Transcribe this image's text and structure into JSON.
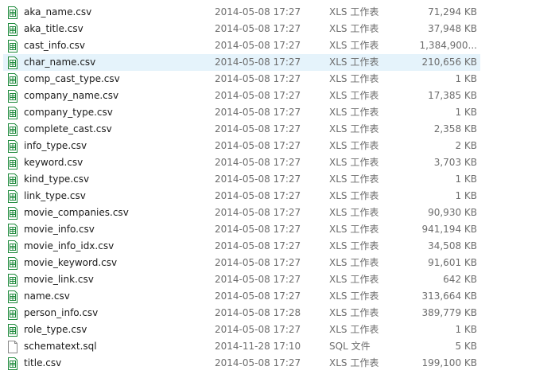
{
  "files": [
    {
      "name": "aka_name.csv",
      "date": "2014-05-08 17:27",
      "type": "XLS 工作表",
      "size": "71,294 KB",
      "icon": "xls-file-icon"
    },
    {
      "name": "aka_title.csv",
      "date": "2014-05-08 17:27",
      "type": "XLS 工作表",
      "size": "37,948 KB",
      "icon": "xls-file-icon"
    },
    {
      "name": "cast_info.csv",
      "date": "2014-05-08 17:27",
      "type": "XLS 工作表",
      "size": "1,384,900...",
      "icon": "xls-file-icon"
    },
    {
      "name": "char_name.csv",
      "date": "2014-05-08 17:27",
      "type": "XLS 工作表",
      "size": "210,656 KB",
      "icon": "xls-file-icon",
      "selected": true
    },
    {
      "name": "comp_cast_type.csv",
      "date": "2014-05-08 17:27",
      "type": "XLS 工作表",
      "size": "1 KB",
      "icon": "xls-file-icon"
    },
    {
      "name": "company_name.csv",
      "date": "2014-05-08 17:27",
      "type": "XLS 工作表",
      "size": "17,385 KB",
      "icon": "xls-file-icon"
    },
    {
      "name": "company_type.csv",
      "date": "2014-05-08 17:27",
      "type": "XLS 工作表",
      "size": "1 KB",
      "icon": "xls-file-icon"
    },
    {
      "name": "complete_cast.csv",
      "date": "2014-05-08 17:27",
      "type": "XLS 工作表",
      "size": "2,358 KB",
      "icon": "xls-file-icon"
    },
    {
      "name": "info_type.csv",
      "date": "2014-05-08 17:27",
      "type": "XLS 工作表",
      "size": "2 KB",
      "icon": "xls-file-icon"
    },
    {
      "name": "keyword.csv",
      "date": "2014-05-08 17:27",
      "type": "XLS 工作表",
      "size": "3,703 KB",
      "icon": "xls-file-icon"
    },
    {
      "name": "kind_type.csv",
      "date": "2014-05-08 17:27",
      "type": "XLS 工作表",
      "size": "1 KB",
      "icon": "xls-file-icon"
    },
    {
      "name": "link_type.csv",
      "date": "2014-05-08 17:27",
      "type": "XLS 工作表",
      "size": "1 KB",
      "icon": "xls-file-icon"
    },
    {
      "name": "movie_companies.csv",
      "date": "2014-05-08 17:27",
      "type": "XLS 工作表",
      "size": "90,930 KB",
      "icon": "xls-file-icon"
    },
    {
      "name": "movie_info.csv",
      "date": "2014-05-08 17:27",
      "type": "XLS 工作表",
      "size": "941,194 KB",
      "icon": "xls-file-icon"
    },
    {
      "name": "movie_info_idx.csv",
      "date": "2014-05-08 17:27",
      "type": "XLS 工作表",
      "size": "34,508 KB",
      "icon": "xls-file-icon"
    },
    {
      "name": "movie_keyword.csv",
      "date": "2014-05-08 17:27",
      "type": "XLS 工作表",
      "size": "91,601 KB",
      "icon": "xls-file-icon"
    },
    {
      "name": "movie_link.csv",
      "date": "2014-05-08 17:27",
      "type": "XLS 工作表",
      "size": "642 KB",
      "icon": "xls-file-icon"
    },
    {
      "name": "name.csv",
      "date": "2014-05-08 17:27",
      "type": "XLS 工作表",
      "size": "313,664 KB",
      "icon": "xls-file-icon"
    },
    {
      "name": "person_info.csv",
      "date": "2014-05-08 17:28",
      "type": "XLS 工作表",
      "size": "389,779 KB",
      "icon": "xls-file-icon"
    },
    {
      "name": "role_type.csv",
      "date": "2014-05-08 17:27",
      "type": "XLS 工作表",
      "size": "1 KB",
      "icon": "xls-file-icon"
    },
    {
      "name": "schematext.sql",
      "date": "2014-11-28 17:10",
      "type": "SQL 文件",
      "size": "5 KB",
      "icon": "sql-file-icon"
    },
    {
      "name": "title.csv",
      "date": "2014-05-08 17:27",
      "type": "XLS 工作表",
      "size": "199,100 KB",
      "icon": "xls-file-icon"
    }
  ],
  "colors": {
    "selected_row": "#e5f3fb",
    "xls_icon": "#1e8a3c",
    "text_secondary": "#6d6d6d"
  }
}
